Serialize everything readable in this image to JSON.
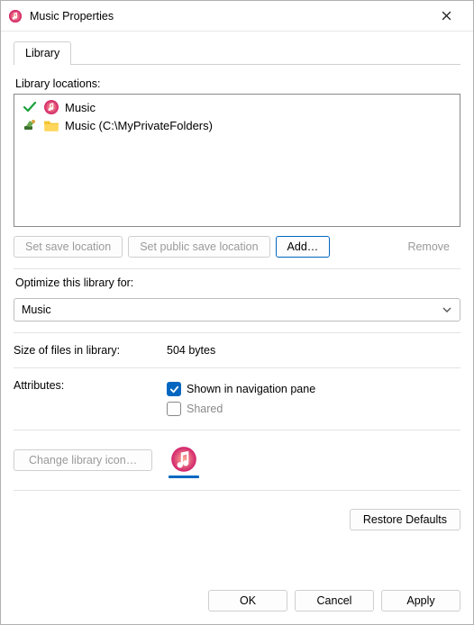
{
  "window": {
    "title": "Music Properties",
    "close_name": "close"
  },
  "tabs": [
    {
      "label": "Library"
    }
  ],
  "locations": {
    "heading": "Library locations:",
    "items": [
      {
        "status_icon": "check-icon",
        "folder_icon": "music-folder-icon",
        "label": "Music"
      },
      {
        "status_icon": "tool-icon",
        "folder_icon": "folder-icon",
        "label": "Music (C:\\MyPrivateFolders)"
      }
    ],
    "buttons": {
      "set_save": "Set save location",
      "set_public": "Set public save location",
      "add": "Add…",
      "remove": "Remove"
    }
  },
  "optimize": {
    "label": "Optimize this library for:",
    "value": "Music"
  },
  "size": {
    "label": "Size of files in library:",
    "value": "504 bytes"
  },
  "attributes": {
    "label": "Attributes:",
    "shown_label": "Shown in navigation pane",
    "shown_checked": true,
    "shared_label": "Shared",
    "shared_checked": false
  },
  "change_icon": {
    "button": "Change library icon…"
  },
  "footer": {
    "restore": "Restore Defaults",
    "ok": "OK",
    "cancel": "Cancel",
    "apply": "Apply"
  }
}
